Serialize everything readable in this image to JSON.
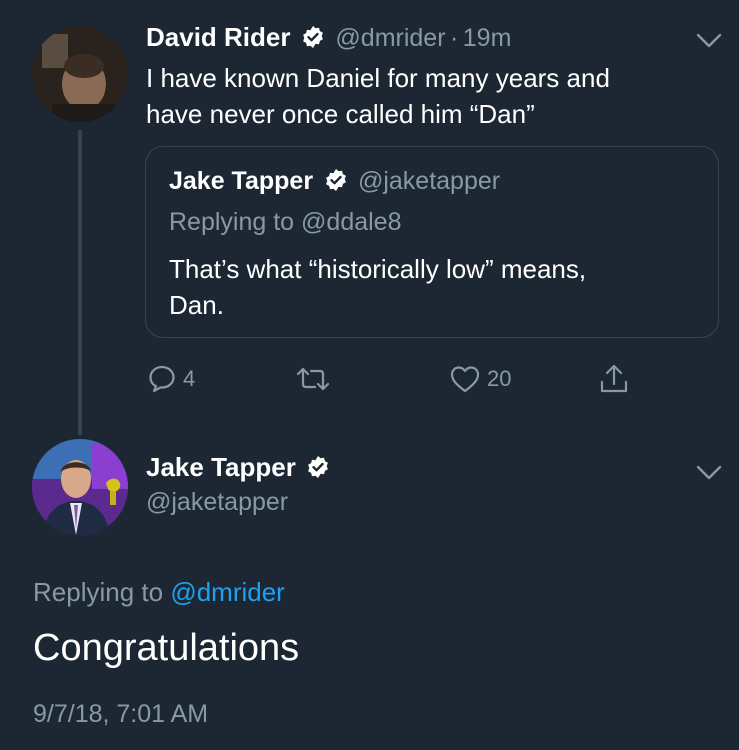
{
  "first_tweet": {
    "author_name": "David Rider",
    "author_handle": "@dmrider",
    "separator": "·",
    "time_ago": "19m",
    "text_line1": "I have known Daniel for many years and",
    "text_line2": "have never once called him “Dan”",
    "quoted": {
      "author_name": "Jake Tapper",
      "author_handle": "@jaketapper",
      "replying_prefix": "Replying to",
      "replying_to": "@ddale8",
      "text_line1": "That’s what “historically low” means,",
      "text_line2": "Dan."
    },
    "actions": {
      "reply_count": "4",
      "retweet_count": "",
      "like_count": "20"
    }
  },
  "main_tweet": {
    "author_name": "Jake Tapper",
    "author_handle": "@jaketapper",
    "replying_prefix": "Replying to",
    "replying_to": "@dmrider",
    "text": "Congratulations",
    "timestamp": "9/7/18, 7:01 AM"
  },
  "colors": {
    "background": "#1c2733",
    "muted": "#8899a6",
    "link": "#1da1f2",
    "border": "#38444d"
  }
}
